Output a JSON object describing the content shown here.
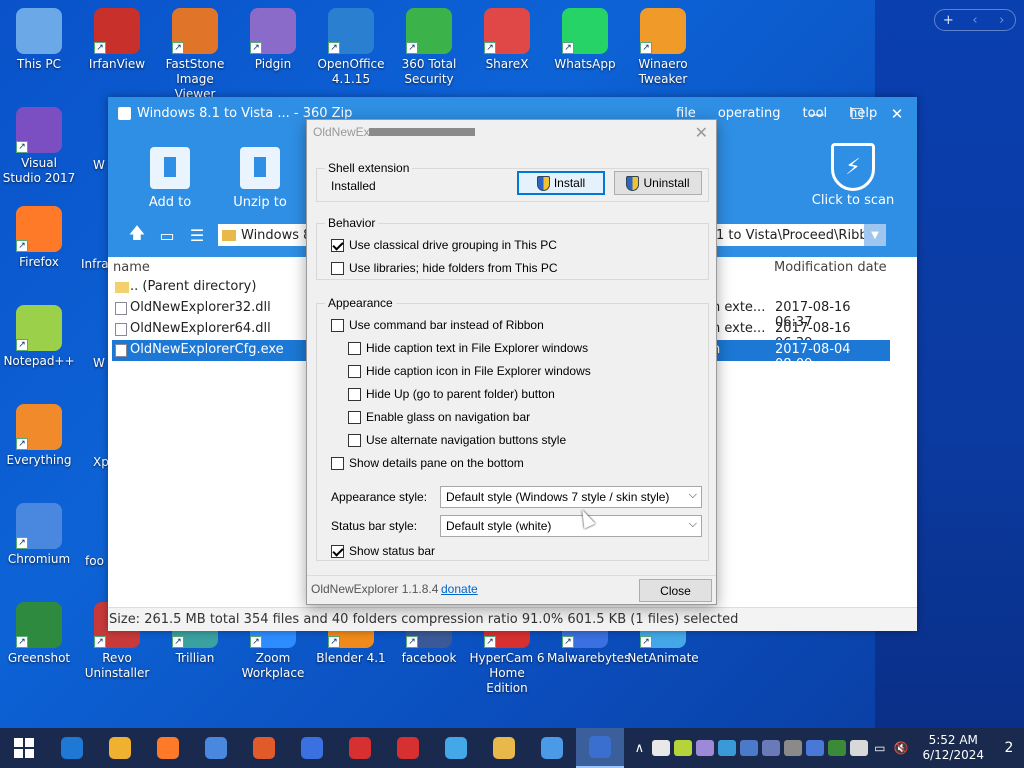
{
  "desktop": {
    "icons": [
      {
        "label": "This PC",
        "color": "#6aa8e8"
      },
      {
        "label": "IrfanView",
        "color": "#c8302c"
      },
      {
        "label": "FastStone Image Viewer",
        "color": "#e0752a"
      },
      {
        "label": "Pidgin",
        "color": "#8a6bc9"
      },
      {
        "label": "OpenOffice 4.1.15",
        "color": "#2b7fd1"
      },
      {
        "label": "360 Total Security",
        "color": "#3bb24a"
      },
      {
        "label": "ShareX",
        "color": "#e04848"
      },
      {
        "label": "WhatsApp",
        "color": "#25d366"
      },
      {
        "label": "Winaero Tweaker",
        "color": "#f09a2a"
      },
      {
        "label": "Visual Studio 2017",
        "color": "#7b4fc2"
      },
      {
        "label": "Firefox",
        "color": "#ff7a28"
      },
      {
        "label": "Notepad++",
        "color": "#9bd04a"
      },
      {
        "label": "Everything",
        "color": "#f08a2a"
      },
      {
        "label": "Chromium",
        "color": "#4a88e0"
      },
      {
        "label": "Greenshot",
        "color": "#2e8a3e"
      },
      {
        "label": "Revo Uninstaller",
        "color": "#c83a3a"
      },
      {
        "label": "Trillian",
        "color": "#3aa0a0"
      },
      {
        "label": "Zoom Workplace",
        "color": "#2d8cff"
      },
      {
        "label": "Blender 4.1",
        "color": "#f08a1a"
      },
      {
        "label": "facebook",
        "color": "#3b5998"
      },
      {
        "label": "HyperCam 6 Home Edition",
        "color": "#d83030"
      },
      {
        "label": "Malwarebytes",
        "color": "#3a70e0"
      },
      {
        "label": "NetAnimate",
        "color": "#44a8e8"
      }
    ],
    "partial_labels": [
      "W",
      "Infra",
      "W",
      "Xp",
      "foo"
    ]
  },
  "zip": {
    "title": "Windows 8.1 to Vista ... - 360 Zip",
    "menu": [
      "file",
      "operating",
      "tool",
      "help"
    ],
    "tools": [
      {
        "label": "Add to"
      },
      {
        "label": "Unzip to"
      }
    ],
    "scan_label": "Click to scan",
    "address_left": "Windows 8",
    "address_right": "1 to Vista\\Proceed\\Ribbc",
    "col_name": "name",
    "col_date": "Modification date",
    "files": [
      {
        "name": ".. (Parent directory)",
        "type": "",
        "date": ""
      },
      {
        "name": "OldNewExplorer32.dll",
        "type": "n exte...",
        "date": "2017-08-16 06:37"
      },
      {
        "name": "OldNewExplorer64.dll",
        "type": "n exte...",
        "date": "2017-08-16 06:39"
      },
      {
        "name": "OldNewExplorerCfg.exe",
        "type": "n",
        "date": "2017-08-04 08:09"
      }
    ],
    "status": "Size: 261.5 MB total 354 files and 40 folders compression ratio 91.0% 601.5 KB (1 files) selected"
  },
  "dialog": {
    "title_visible": "OldNewEx",
    "shell": {
      "label": "Shell extension",
      "state": "Installed",
      "install": "Install",
      "uninstall": "Uninstall"
    },
    "behavior": {
      "label": "Behavior",
      "items": [
        {
          "label": "Use classical drive grouping in This PC",
          "checked": true
        },
        {
          "label": "Use libraries; hide folders from This PC",
          "checked": false
        }
      ]
    },
    "appearance": {
      "label": "Appearance",
      "items": [
        {
          "label": "Use command bar instead of Ribbon",
          "checked": false
        },
        {
          "label": "Hide caption text in File Explorer windows",
          "checked": false
        },
        {
          "label": "Hide caption icon in File Explorer windows",
          "checked": false
        },
        {
          "label": "Hide Up (go to parent folder) button",
          "checked": false
        },
        {
          "label": "Enable glass on navigation bar",
          "checked": false
        },
        {
          "label": "Use alternate navigation buttons style",
          "checked": false
        },
        {
          "label": "Show details pane on the bottom",
          "checked": false
        }
      ],
      "style_label": "Appearance style:",
      "style_value": "Default style (Windows 7 style / skin style)",
      "status_label": "Status bar style:",
      "status_value": "Default style (white)",
      "show_status": {
        "label": "Show status bar",
        "checked": true
      }
    },
    "version": "OldNewExplorer 1.1.8.4",
    "donate": "donate",
    "close": "Close"
  },
  "taskbar": {
    "time": "5:52 AM",
    "date": "6/12/2024",
    "notifications": "2",
    "apps": [
      "#1e78d4",
      "#f0b030",
      "#ff7a28",
      "#4a88e0",
      "#e05a2a",
      "#3a70e0",
      "#d83030",
      "#d83030",
      "#44a8e8",
      "#e8b84a",
      "#4a9ae8",
      "#3a6fd0"
    ]
  }
}
